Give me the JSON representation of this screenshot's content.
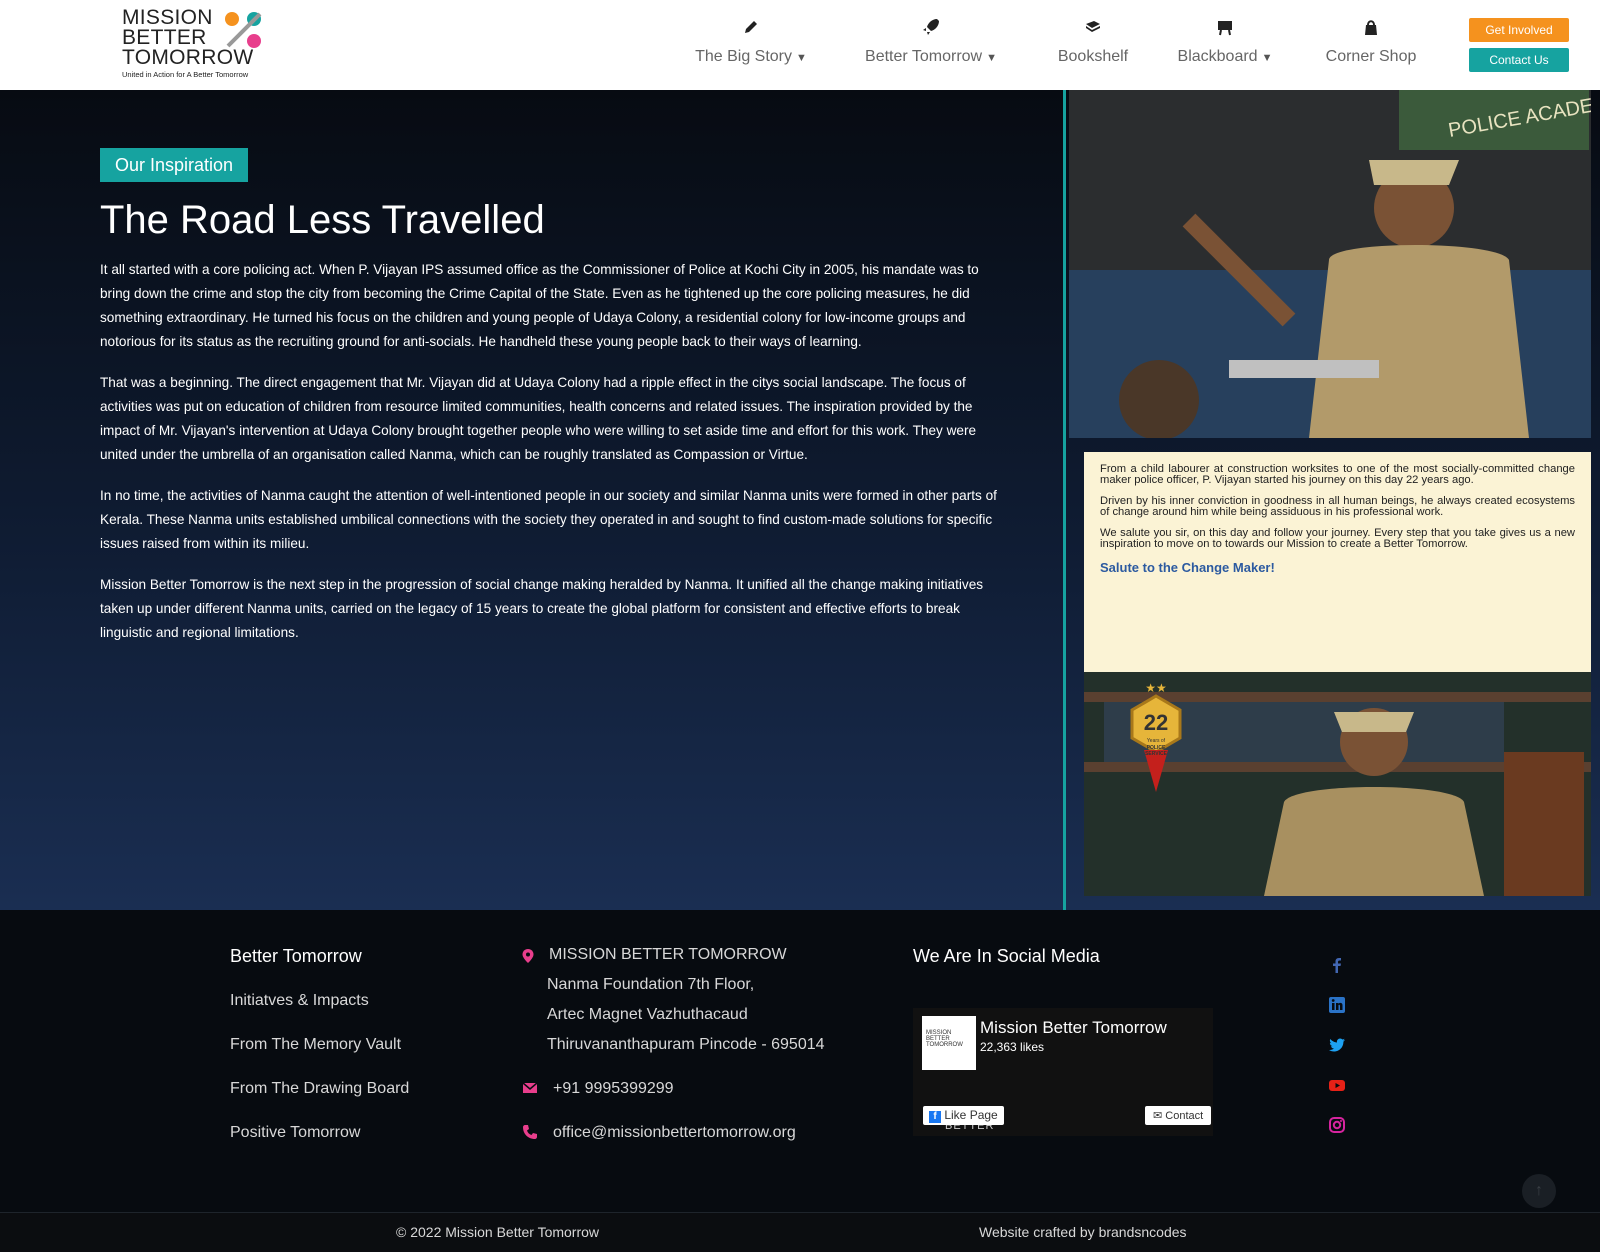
{
  "header": {
    "logo": {
      "line1": "MISSION",
      "line2": "BETTER",
      "line3": "TOMORROW",
      "tagline": "United in Action for A Better Tomorrow"
    },
    "nav": [
      {
        "label": "The Big Story",
        "icon": "pencil-icon",
        "has_dropdown": true
      },
      {
        "label": "Better Tomorrow",
        "icon": "rocket-icon",
        "has_dropdown": true
      },
      {
        "label": "Bookshelf",
        "icon": "book-icon",
        "has_dropdown": false
      },
      {
        "label": "Blackboard",
        "icon": "easel-icon",
        "has_dropdown": true
      },
      {
        "label": "Corner Shop",
        "icon": "shopping-bag-icon",
        "has_dropdown": false
      }
    ],
    "get_involved": "Get Involved",
    "contact_us": "Contact Us"
  },
  "hero": {
    "tag": "Our Inspiration",
    "title": "The Road Less Travelled",
    "paragraphs": [
      "It all started with a core policing act. When P. Vijayan IPS assumed office as the Commissioner of Police at Kochi City in 2005, his mandate was to bring down the crime and stop the city from becoming the Crime Capital of the State. Even as he tightened up the core policing measures, he did something extraordinary. He turned his focus on the children and young people of Udaya Colony, a residential colony for low-income groups and notorious for its status as the recruiting ground for anti-socials. He handheld these young people back to their ways of learning.",
      "That was a beginning. The direct engagement that Mr. Vijayan did at Udaya Colony had a ripple effect in the citys social landscape. The focus of activities was put on education of children from resource limited communities, health concerns and related issues. The inspiration provided by the impact of Mr. Vijayan's intervention at Udaya Colony brought together people who were willing to set aside time and effort for this work. They were united under the umbrella of an organisation called Nanma, which can be roughly translated as Compassion or Virtue.",
      "In no time, the activities of Nanma caught the attention of well-intentioned people in our society and similar Nanma units were formed in other parts of Kerala. These Nanma units established umbilical connections with the society they operated in and sought to find custom-made solutions for specific issues raised from within its milieu.",
      "Mission Better Tomorrow is the next step in the progression of social change making heralded by Nanma. It unified all the change making initiatives taken up under different Nanma units, carried on the legacy of 15 years to create the global platform for consistent and effective efforts to break linguistic and regional limitations."
    ],
    "card": {
      "p1": "From a child labourer at construction worksites to one of the most socially-committed change maker police officer, P. Vijayan started his journey on this day 22 years ago.",
      "p2": "Driven by his inner conviction in goodness in all human beings, he always created ecosystems of change around him while being assiduous in his professional work.",
      "p3": "We salute you sir, on this day and follow your journey. Every step that you take gives us a new inspiration to move on to towards our Mission to create a Better Tomorrow.",
      "salute": "Salute to the Change Maker!"
    },
    "photo1_sign": "POLICE ACADEMY",
    "badge": {
      "number": "22",
      "line1": "Years of",
      "line2": "POLICE",
      "line3": "SERVICE"
    }
  },
  "footer": {
    "col1": {
      "heading": "Better Tomorrow",
      "links": [
        "Initiatves & Impacts",
        "From The Memory Vault",
        "From The Drawing Board",
        "Positive Tomorrow"
      ]
    },
    "col2": {
      "org": "MISSION BETTER TOMORROW",
      "address": [
        "Nanma Foundation 7th Floor,",
        "Artec Magnet Vazhuthacaud",
        "Thiruvananthapuram Pincode - 695014"
      ],
      "phone": "+91 9995399299",
      "email": "office@missionbettertomorrow.org"
    },
    "col3": {
      "heading": "We Are In Social Media",
      "fb_name": "Mission Better Tomorrow",
      "fb_likes": "22,363 likes",
      "fb_like_btn": "Like Page",
      "fb_contact_btn": "Contact",
      "fb_thumb": "MISSION BETTER TOMORROW",
      "fb_watermark": "BETTER"
    },
    "social": [
      "facebook-icon",
      "linkedin-icon",
      "twitter-icon",
      "youtube-icon",
      "instagram-icon"
    ],
    "copyright": "© 2022 Mission Better Tomorrow",
    "credit": "Website crafted by brandsncodes",
    "scroll_top": "↑"
  },
  "colors": {
    "teal": "#16a3a0",
    "orange": "#f5921e",
    "pink": "#e83e8c"
  }
}
